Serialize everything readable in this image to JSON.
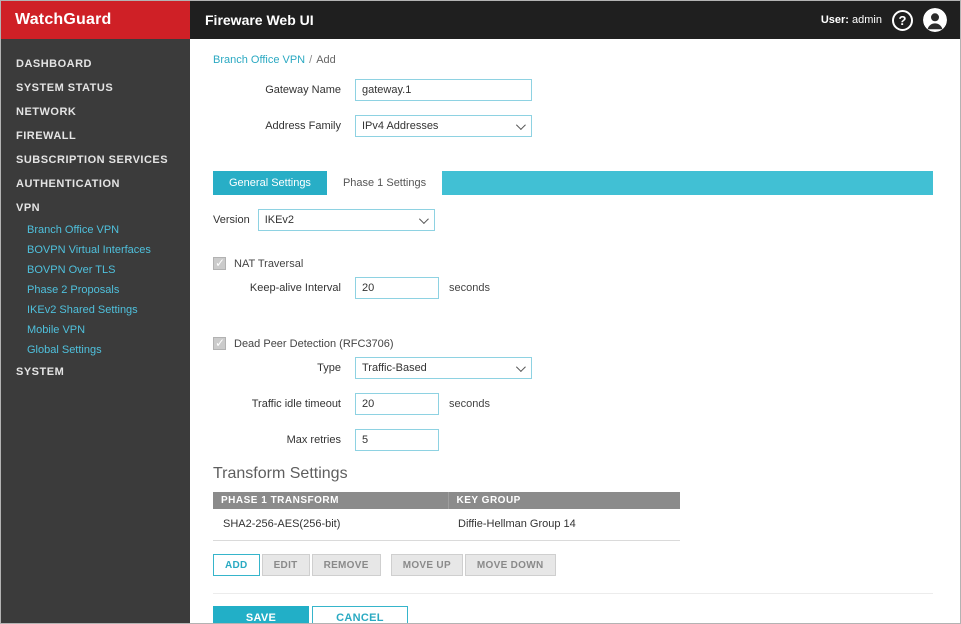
{
  "header": {
    "logo_text": "WatchGuard",
    "app_title": "Fireware Web UI",
    "user_label": "User:",
    "user_name": "admin",
    "help_glyph": "?"
  },
  "sidebar": {
    "items": [
      {
        "label": "DASHBOARD"
      },
      {
        "label": "SYSTEM STATUS"
      },
      {
        "label": "NETWORK"
      },
      {
        "label": "FIREWALL"
      },
      {
        "label": "SUBSCRIPTION SERVICES"
      },
      {
        "label": "AUTHENTICATION"
      },
      {
        "label": "VPN"
      },
      {
        "label": "SYSTEM"
      }
    ],
    "vpn_subitems": [
      {
        "label": "Branch Office VPN"
      },
      {
        "label": "BOVPN Virtual Interfaces"
      },
      {
        "label": "BOVPN Over TLS"
      },
      {
        "label": "Phase 2 Proposals"
      },
      {
        "label": "IKEv2 Shared Settings"
      },
      {
        "label": "Mobile VPN"
      },
      {
        "label": "Global Settings"
      }
    ]
  },
  "breadcrumb": {
    "parent": "Branch Office VPN",
    "separator": "/",
    "current": "Add"
  },
  "gateway_form": {
    "name_label": "Gateway Name",
    "name_value": "gateway.1",
    "family_label": "Address Family",
    "family_value": "IPv4 Addresses"
  },
  "tabs": [
    {
      "label": "General Settings"
    },
    {
      "label": "Phase 1 Settings"
    }
  ],
  "phase1": {
    "version_label": "Version",
    "version_value": "IKEv2",
    "nat_traversal_label": "NAT Traversal",
    "keep_alive_label": "Keep-alive Interval",
    "keep_alive_value": "20",
    "keep_alive_unit": "seconds",
    "dpd_label": "Dead Peer Detection (RFC3706)",
    "dpd_type_label": "Type",
    "dpd_type_value": "Traffic-Based",
    "idle_timeout_label": "Traffic idle timeout",
    "idle_timeout_value": "20",
    "idle_timeout_unit": "seconds",
    "max_retries_label": "Max retries",
    "max_retries_value": "5"
  },
  "transform_settings": {
    "title": "Transform Settings",
    "columns": [
      "PHASE 1 TRANSFORM",
      "KEY GROUP"
    ],
    "rows": [
      {
        "transform": "SHA2-256-AES(256-bit)",
        "key_group": "Diffie-Hellman Group 14"
      }
    ],
    "buttons": {
      "add": "ADD",
      "edit": "EDIT",
      "remove": "REMOVE",
      "move_up": "MOVE UP",
      "move_down": "MOVE DOWN"
    }
  },
  "footer": {
    "save": "SAVE",
    "cancel": "CANCEL"
  },
  "colors": {
    "accent": "#29b2c9",
    "brand_red": "#cf2026",
    "sidebar_bg": "#3b3b3b",
    "tab_bar": "#41c0d4"
  }
}
